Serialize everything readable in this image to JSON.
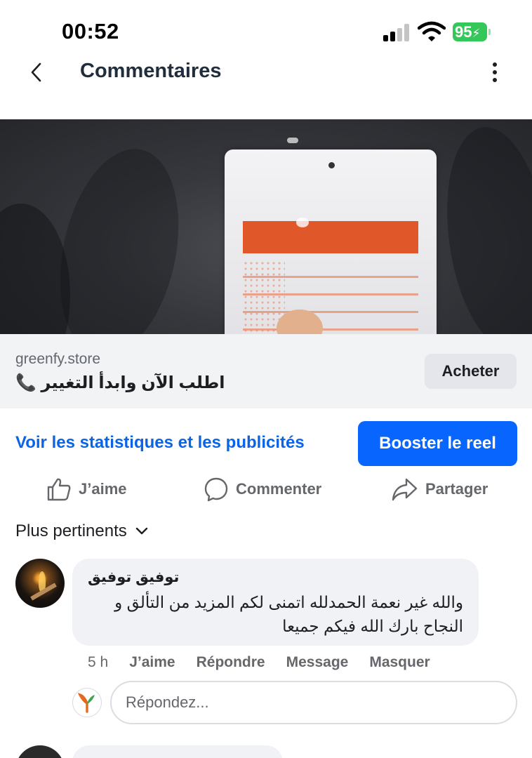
{
  "status_bar": {
    "time": "00:52",
    "battery_level": "95",
    "battery_color": "#34c759"
  },
  "header": {
    "title": "Commentaires",
    "back_icon": "chevron-left-icon",
    "more_icon": "more-vertical-icon"
  },
  "ad": {
    "domain": "greenfy.store",
    "headline": "اطلب الآن وابدأ التغيير 📞",
    "cta_label": "Acheter"
  },
  "insights": {
    "stats_link": "Voir les statistiques et les publicités",
    "boost_label": "Booster le reel",
    "accent_color": "#0866ff"
  },
  "actions": {
    "like": "J’aime",
    "comment": "Commenter",
    "share": "Partager"
  },
  "sort": {
    "label": "Plus pertinents"
  },
  "comments": [
    {
      "author": "توفيق توفيق",
      "text": "والله غير نعمة الحمدلله اتمنى لكم المزيد من التألق و النجاح بارك الله فيكم جميعا",
      "time": "5 h",
      "like_label": "J’aime",
      "reply_label": "Répondre",
      "message_label": "Message",
      "hide_label": "Masquer"
    }
  ],
  "reply": {
    "placeholder": "Répondez..."
  }
}
